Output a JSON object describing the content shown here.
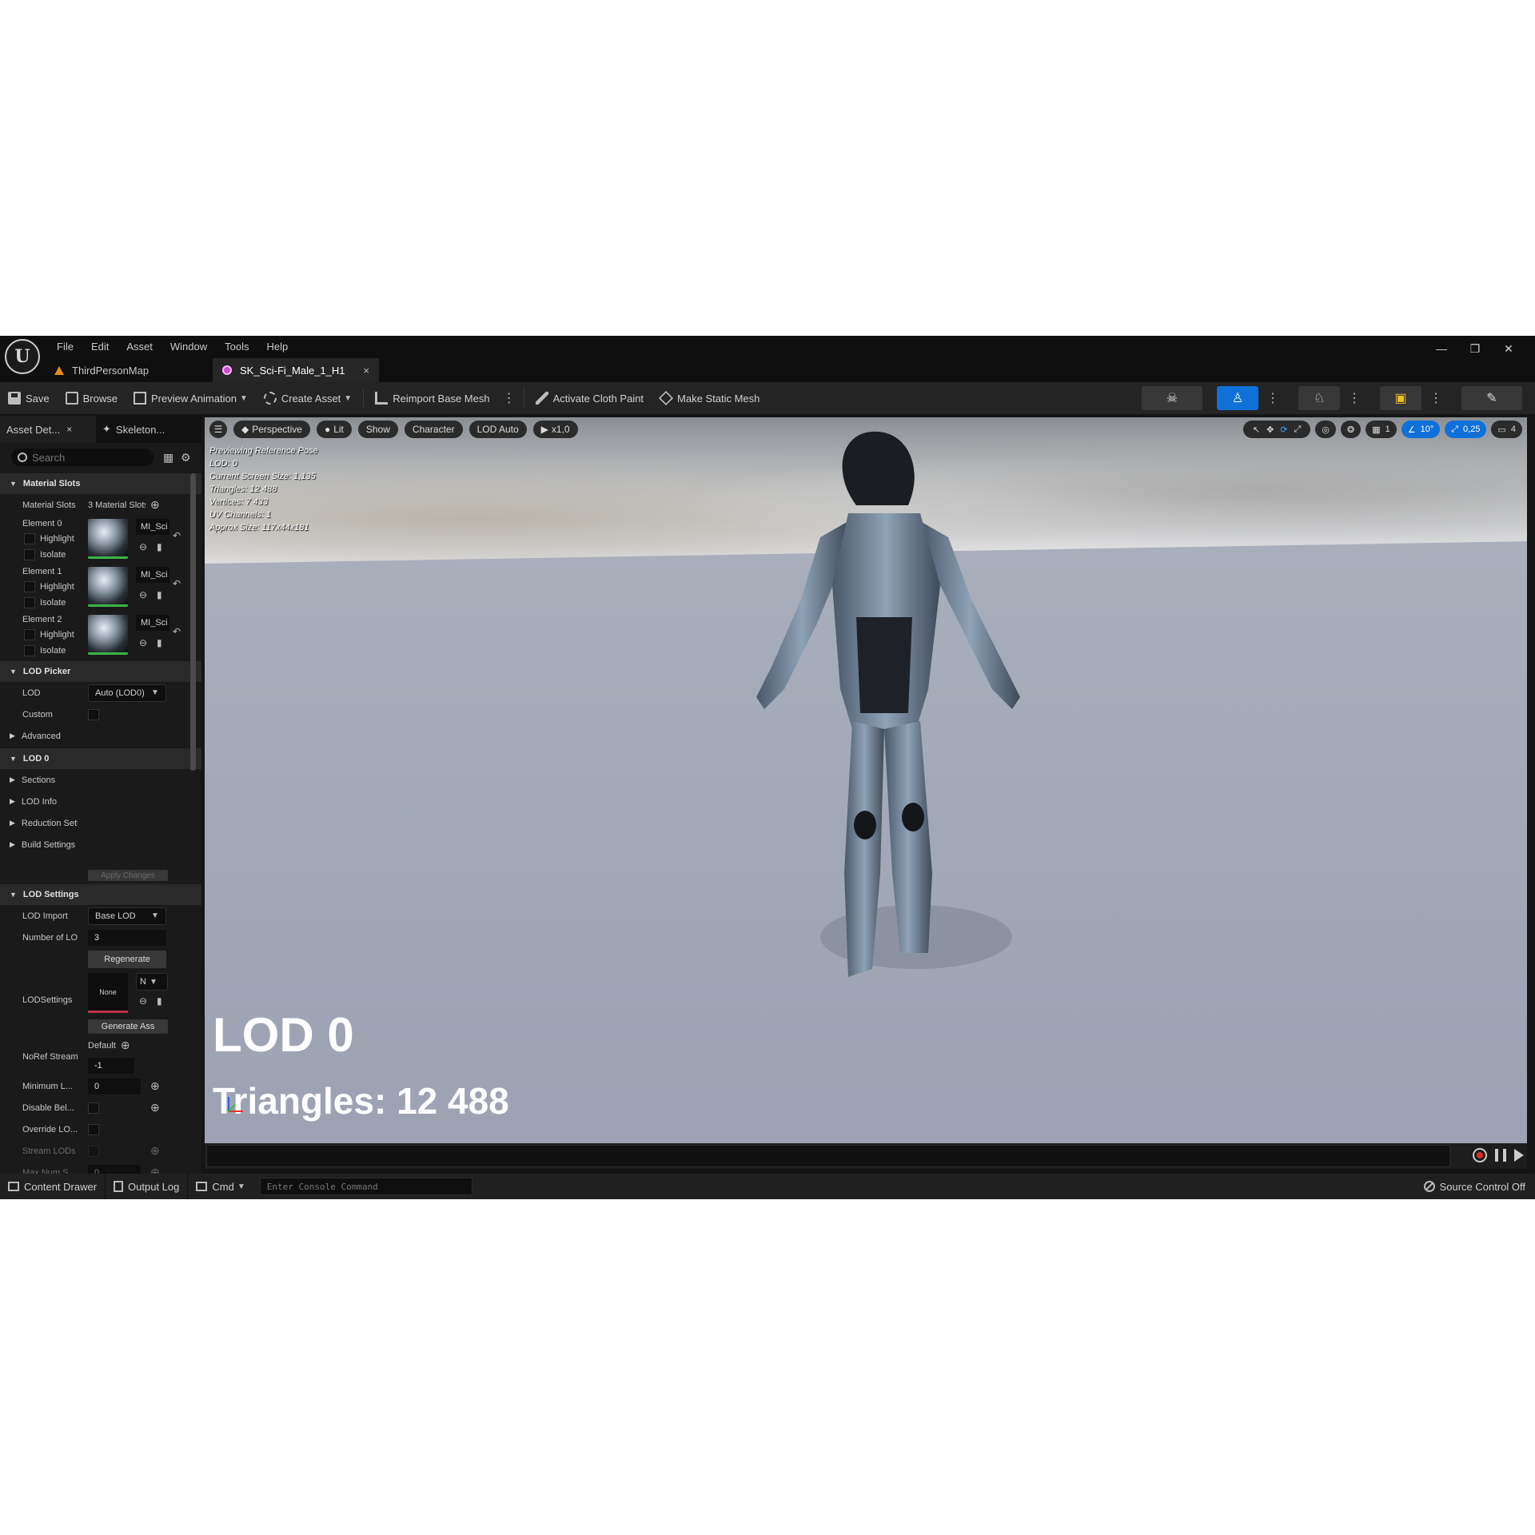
{
  "menu": [
    "File",
    "Edit",
    "Asset",
    "Window",
    "Tools",
    "Help"
  ],
  "tabs": [
    {
      "label": "ThirdPersonMap"
    },
    {
      "label": "SK_Sci-Fi_Male_1_H1",
      "close": "×"
    }
  ],
  "window_controls": {
    "minimize": "—",
    "restore": "❐",
    "close": "✕"
  },
  "toolbar": {
    "save": "Save",
    "browse": "Browse",
    "preview_animation": "Preview Animation",
    "create_asset": "Create Asset",
    "reimport": "Reimport Base Mesh",
    "cloth_paint": "Activate Cloth Paint",
    "make_static": "Make Static Mesh"
  },
  "left_panel": {
    "tabs": [
      {
        "label": "Asset Det...",
        "close": "×"
      },
      {
        "label": "Skeleton..."
      }
    ],
    "search_placeholder": "Search",
    "material_slots": {
      "header": "Material Slots",
      "label": "Material Slots",
      "value": "3 Material Slots",
      "elements": [
        {
          "name": "Element 0",
          "highlight": "Highlight",
          "isolate": "Isolate",
          "material": "MI_Sci"
        },
        {
          "name": "Element 1",
          "highlight": "Highlight",
          "isolate": "Isolate",
          "material": "MI_Sci"
        },
        {
          "name": "Element 2",
          "highlight": "Highlight",
          "isolate": "Isolate",
          "material": "MI_Sci"
        }
      ]
    },
    "lod_picker": {
      "header": "LOD Picker",
      "lod_label": "LOD",
      "lod_value": "Auto (LOD0)",
      "custom_label": "Custom",
      "advanced": "Advanced"
    },
    "lod0": {
      "header": "LOD 0",
      "items": [
        "Sections",
        "LOD Info",
        "Reduction Settings",
        "Build Settings"
      ],
      "apply": "Apply Changes"
    },
    "lod_settings": {
      "header": "LOD Settings",
      "lod_import_label": "LOD Import",
      "lod_import_value": "Base LOD",
      "number_label": "Number of LODs",
      "number_value": "3",
      "regenerate": "Regenerate",
      "lodsettings_label": "LODSettings",
      "lodsettings_thumb": "None",
      "lodsettings_combo": "N",
      "generate": "Generate Ass",
      "noref_label": "NoRef Streaming",
      "noref_value": "Default",
      "noref_num": "-1",
      "minimum_label": "Minimum L...",
      "minimum_value": "0",
      "disable_label": "Disable Bel...",
      "override_label": "Override LO...",
      "stream_label": "Stream LODs",
      "maxnum_label": "Max Num S...",
      "maxnum_value": "0"
    }
  },
  "viewport": {
    "pills": [
      "Perspective",
      "Lit",
      "Show",
      "Character",
      "LOD Auto",
      "x1,0"
    ],
    "right_values": {
      "grid": "1",
      "angle": "10°",
      "scale": "0,25",
      "camera": "4"
    },
    "stats": [
      "Previewing Reference Pose",
      "LOD: 0",
      "Current Screen Size: 1,135",
      "Triangles: 12 488",
      "Vertices: 7 433",
      "UV Channels: 1",
      "Approx Size: 117x44x181"
    ],
    "overlay_lod": "LOD 0",
    "overlay_triangles": "Triangles: 12 488"
  },
  "statusbar": {
    "content_drawer": "Content Drawer",
    "output_log": "Output Log",
    "cmd": "Cmd",
    "console_placeholder": "Enter Console Command",
    "source_control": "Source Control Off"
  },
  "colors": {
    "accent_blue": "#0f70d9",
    "bg_dark": "#151515",
    "thumb_green": "#3ab44a"
  }
}
